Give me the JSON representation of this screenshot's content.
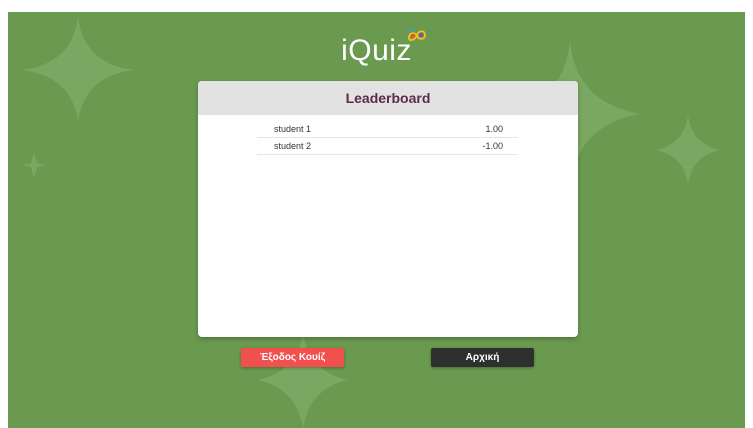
{
  "logo": {
    "text": "iQuiz",
    "mark_icon": "infinity-loop-icon"
  },
  "leaderboard": {
    "title": "Leaderboard",
    "rows": [
      {
        "name": "student 1",
        "score": "1.00"
      },
      {
        "name": "student 2",
        "score": "-1.00"
      }
    ]
  },
  "buttons": {
    "exit_label": "Έξοδος Κουίζ",
    "home_label": "Αρχική"
  },
  "colors": {
    "background": "#6a9a4f",
    "title": "#5b2a4f",
    "exit_button": "#f24f4f",
    "home_button": "#2f2f2f"
  }
}
